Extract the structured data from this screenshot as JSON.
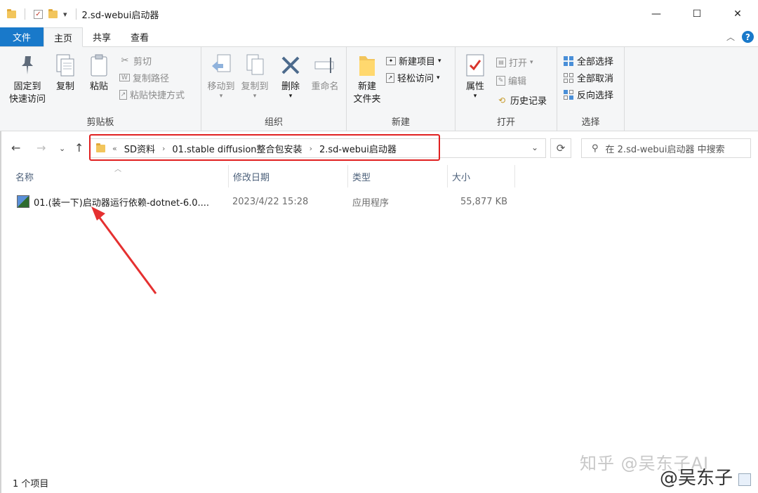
{
  "window": {
    "title": "2.sd-webui启动器",
    "qa_dropdown": "▾",
    "controls": {
      "minimize": "—",
      "maximize": "☐",
      "close": "✕"
    }
  },
  "ribbon_tabs": [
    "文件",
    "主页",
    "共享",
    "查看"
  ],
  "ribbon": {
    "clipboard": {
      "label": "剪贴板",
      "pin": [
        "固定到",
        "快速访问"
      ],
      "copy": "复制",
      "paste": "粘贴",
      "cut": "剪切",
      "copy_path": "复制路径",
      "paste_shortcut": "粘贴快捷方式"
    },
    "organize": {
      "label": "组织",
      "move_to": "移动到",
      "copy_to": "复制到",
      "delete": "删除",
      "rename": "重命名"
    },
    "new": {
      "label": "新建",
      "new_folder": [
        "新建",
        "文件夹"
      ],
      "new_item": "新建项目",
      "easy_access": "轻松访问"
    },
    "open": {
      "label": "打开",
      "properties": "属性",
      "open": "打开",
      "edit": "编辑",
      "history": "历史记录"
    },
    "select": {
      "label": "选择",
      "select_all": "全部选择",
      "select_none": "全部取消",
      "invert": "反向选择"
    }
  },
  "address": {
    "overflow": "«",
    "crumbs": [
      "SD资料",
      "01.stable diffusion整合包安装",
      "2.sd-webui启动器"
    ],
    "search_placeholder": "在 2.sd-webui启动器 中搜索"
  },
  "columns": [
    "名称",
    "修改日期",
    "类型",
    "大小"
  ],
  "files": [
    {
      "name": "01.(装一下)启动器运行依赖-dotnet-6.0....",
      "modified": "2023/4/22 15:28",
      "type": "应用程序",
      "size": "55,877 KB"
    }
  ],
  "status": {
    "count": "1 个项目"
  },
  "watermarks": {
    "site": "知乎 @吴东子AI",
    "author": "@吴东子"
  },
  "colors": {
    "accent": "#1979ca",
    "highlight": "#e02020",
    "annotation_arrow": "#e53030"
  }
}
